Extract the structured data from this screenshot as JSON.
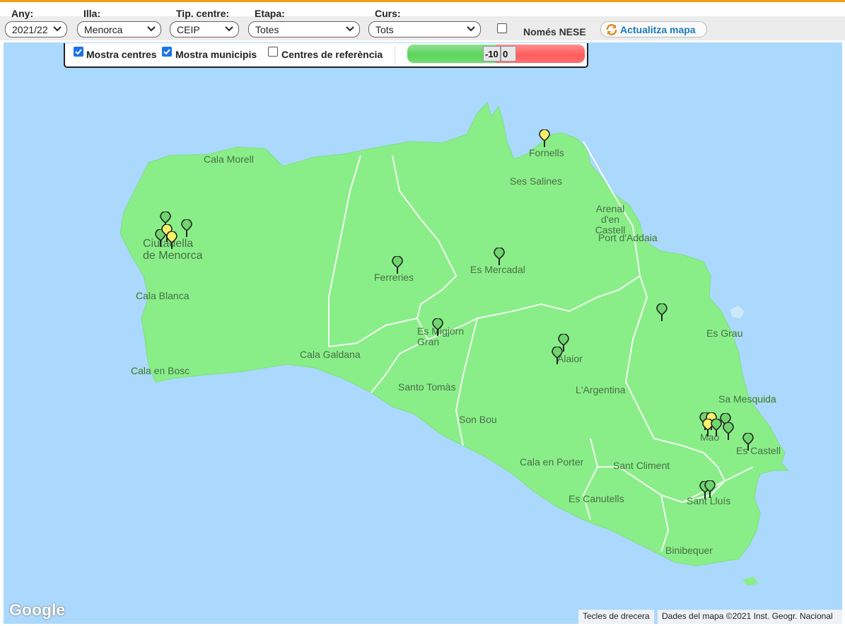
{
  "filters": {
    "year": {
      "label": "Any:",
      "value": "2021/22"
    },
    "island": {
      "label": "Illa:",
      "value": "Menorca"
    },
    "center_type": {
      "label": "Tip. centre:",
      "value": "CEIP"
    },
    "stage": {
      "label": "Etapa:",
      "value": "Totes"
    },
    "course": {
      "label": "Curs:",
      "value": "Tots"
    },
    "nese": {
      "label": "Només NESE",
      "checked": false
    },
    "update_button": "Actualitza mapa"
  },
  "panel": {
    "show_centers": {
      "label": "Mostra centres",
      "checked": true
    },
    "show_municipalities": {
      "label": "Mostra municipis",
      "checked": true
    },
    "reference_centers": {
      "label": "Centres de referència",
      "checked": false
    },
    "scale": {
      "min": "-10",
      "max": "0",
      "low_color": "#5cd55c",
      "high_color": "#ff5c5c"
    }
  },
  "map": {
    "sea_color": "#abd8fd",
    "land_color": "#89ee87",
    "places": [
      "Cala Morell",
      "Ciutadella de Menorca",
      "Cala Blanca",
      "Cala en Bosc",
      "Cala Galdana",
      "Ferreries",
      "Es Migjorn Gran",
      "Santo Tomàs",
      "Son Bou",
      "Es Mercadal",
      "Fornells",
      "Ses Salines",
      "Arenal d'en Castell",
      "Port d'Addaia",
      "Alaior",
      "L'Argentina",
      "Cala en Porter",
      "Es Grau",
      "Sa Mesquida",
      "Maó",
      "Es Castell",
      "Sant Climent",
      "Es Canutells",
      "Sant Lluís",
      "Binibequer"
    ],
    "marker_colors": {
      "green": "#6fd66f",
      "yellow": "#f6f26a"
    }
  },
  "footer": {
    "logo": "Google",
    "shortcuts": "Tecles de drecera",
    "data": "Dades del mapa ©2021 Inst. Geogr. Nacional"
  }
}
